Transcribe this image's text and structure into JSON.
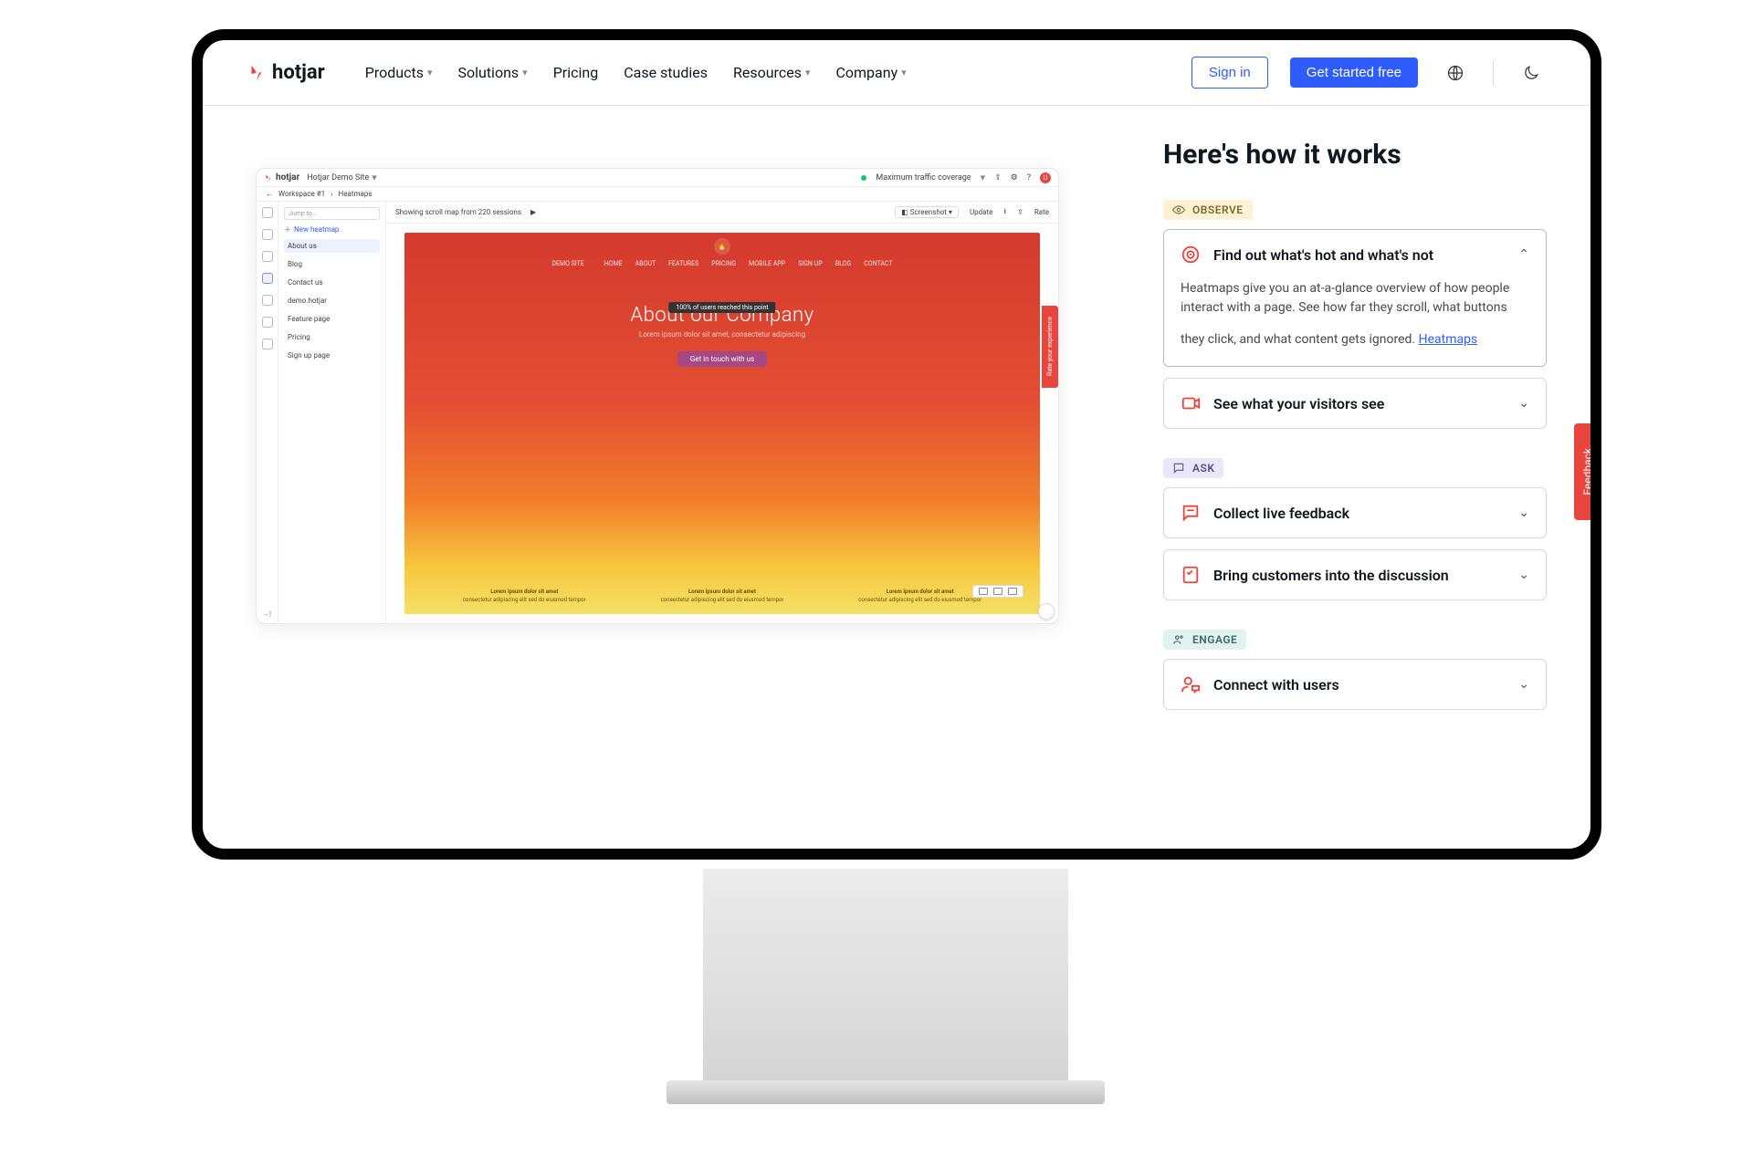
{
  "brand": "hotjar",
  "nav": {
    "items": [
      {
        "label": "Products",
        "dropdown": true
      },
      {
        "label": "Solutions",
        "dropdown": true
      },
      {
        "label": "Pricing",
        "dropdown": false
      },
      {
        "label": "Case studies",
        "dropdown": false
      },
      {
        "label": "Resources",
        "dropdown": true
      },
      {
        "label": "Company",
        "dropdown": true
      }
    ],
    "sign_in": "Sign in",
    "cta": "Get started free"
  },
  "headline": "Here's how it works",
  "feedback_tab": "Feedback",
  "sections": {
    "observe": {
      "tag": "OBSERVE",
      "items": [
        {
          "title": "Find out what's hot and what's not",
          "open": true,
          "body": "Heatmaps give you an at-a-glance overview of how people interact with a page. See how far they scroll, what buttons they click, and what content gets ignored.",
          "link": "Heatmaps"
        },
        {
          "title": "See what your visitors see",
          "open": false
        }
      ]
    },
    "ask": {
      "tag": "ASK",
      "items": [
        {
          "title": "Collect live feedback",
          "open": false
        },
        {
          "title": "Bring customers into the discussion",
          "open": false
        }
      ]
    },
    "engage": {
      "tag": "ENGAGE",
      "items": [
        {
          "title": "Connect with users",
          "open": false
        }
      ]
    }
  },
  "preview": {
    "site_dropdown": "Hotjar Demo Site",
    "coverage": "Maximum traffic coverage",
    "breadcrumb": {
      "workspace": "Workspace #1",
      "page": "Heatmaps"
    },
    "search_placeholder": "Jump to…",
    "new_heatmap": "New heatmap",
    "sidebar_items": [
      "About us",
      "Blog",
      "Contact us",
      "demo.hotjar",
      "Feature page",
      "Pricing",
      "Sign up page"
    ],
    "sidebar_active": "About us",
    "toolbar": {
      "status": "Showing scroll map from 220 sessions",
      "screenshot": "Screenshot",
      "update": "Update",
      "rate": "Rate"
    },
    "heatmap": {
      "site_name": "DEMO SITE",
      "nav": [
        "HOME",
        "ABOUT",
        "FEATURES",
        "PRICING",
        "MOBILE APP",
        "SIGN UP",
        "BLOG",
        "CONTACT"
      ],
      "title": "About our Company",
      "subtitle": "Lorem ipsum dolor sit amet, consectetur adipiscing",
      "cta": "Get in touch with us",
      "badge": "100% of users reached this point",
      "col_heading": "Lorem ipsum dolor sit amet",
      "col_body": "consectetur adipiscing elit sed do eiusmod tempor"
    },
    "feedback_label": "Rate your experience"
  }
}
